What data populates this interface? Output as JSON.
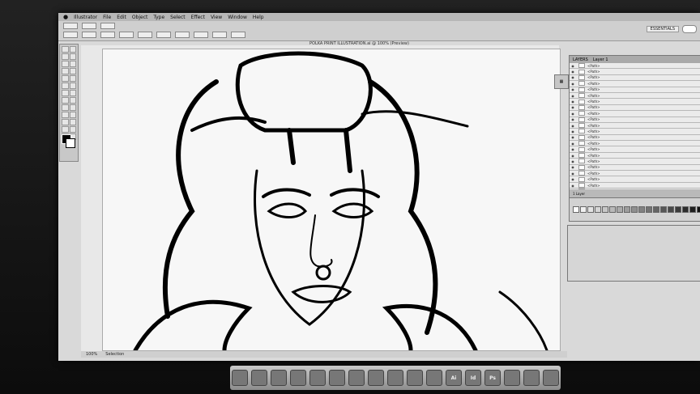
{
  "menubar": {
    "apple": "",
    "items": [
      "Illustrator",
      "File",
      "Edit",
      "Object",
      "Type",
      "Select",
      "Effect",
      "View",
      "Window",
      "Help"
    ]
  },
  "control": {
    "workspace": "ESSENTIALS",
    "document_title": "POLKA PRINT ILLUSTRATION.ai @ 100% (Preview)"
  },
  "toolbox": {
    "tools": [
      "select",
      "direct-select",
      "magic-wand",
      "lasso",
      "pen",
      "type",
      "line",
      "rectangle",
      "paintbrush",
      "pencil",
      "blob-brush",
      "eraser",
      "rotate",
      "scale",
      "warp",
      "free-transform",
      "symbol-sprayer",
      "graph",
      "mesh",
      "gradient",
      "eyedropper",
      "blend",
      "slice",
      "scissors",
      "hand",
      "zoom"
    ]
  },
  "layers": {
    "tab": "LAYERS",
    "top_layer": "Layer 1",
    "item_label": "<Path>",
    "row_count": 24,
    "footer": "1 Layer"
  },
  "status": {
    "zoom": "100%",
    "mode": "Selection"
  },
  "dock": {
    "apps": [
      "Finder",
      "Safari",
      "Mail",
      "iCal",
      "Photo",
      "Preview",
      "iTunes",
      "Chrome",
      "QuickTime",
      "Reader",
      "System",
      "Ai",
      "Id",
      "Ps",
      "VLC",
      "Photos",
      "Trash"
    ]
  },
  "colors": {
    "bezel": "#1a1a1a",
    "app_chrome": "#d9d9d9",
    "artboard": "#f7f7f7"
  }
}
